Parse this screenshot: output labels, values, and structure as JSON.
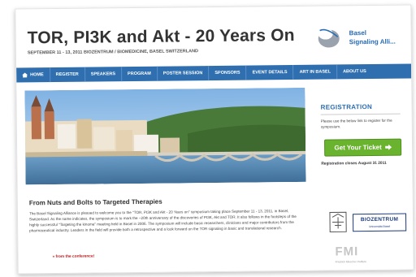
{
  "header": {
    "title": "TOR, PI3K and Akt - 20 Years On",
    "subtitle": "SEPTEMBER 11 - 13, 2011 BIOZENTRUM / BIOMEDICINE, BASEL SWITZERLAND",
    "logo_line1": "Basel",
    "logo_line2": "Signaling Alli..."
  },
  "nav": {
    "items": [
      "HOME",
      "REGISTER",
      "SPEAKERS",
      "PROGRAM",
      "POSTER SESSION",
      "SPONSORS",
      "EVENT DETAILS",
      "ART IN BASEL",
      "ABOUT US"
    ]
  },
  "main": {
    "section_title": "From Nuts and Bolts to Targeted Therapies",
    "paragraph": "The Basel Signaling Alliance is pleased to welcome you to the \"TOR, PI3K and Akt - 20 Years on\" symposium taking place September 11 - 13, 2011, in Basel, Switzerland. As the name indicates, the symposium is to mark the ~20th anniversary of the discoveries of PI3K, Akt and TOR. It also follows in the footsteps of the highly successful \"Targeting the kinome\" meeting held in Basel in 2006. The symposium will include basic researchers, clinicians and major contributors from the pharmaceutical industry. Leaders in the field will provide both a retrospective and a look forward on the TOR signaling in basic and translational research.",
    "link": "» from the conference!"
  },
  "sidebar": {
    "title": "REGISTRATION",
    "text": "Please use the below link to register for the symposium.",
    "button": "Get Your Ticket",
    "closes": "Registration closes August 31 2011"
  },
  "partners": {
    "biozentrum": "BIOZENTRUM",
    "biozentrum_sub": "Universität Basel",
    "fmi": "FMI",
    "fmi_sub": "Friedrich Miescher Institute"
  },
  "colors": {
    "nav_bg": "#2f6fb0",
    "accent_blue": "#2a6db3",
    "button_green": "#6ab32e",
    "link_red": "#c0151b"
  }
}
